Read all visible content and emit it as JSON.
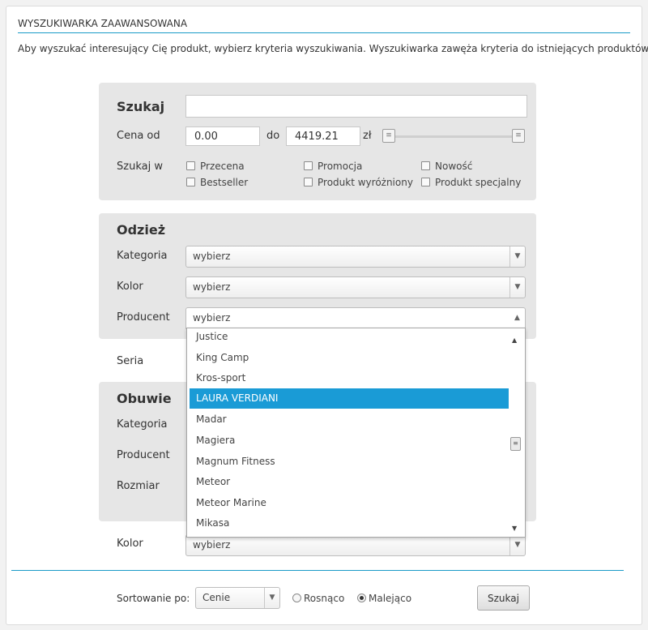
{
  "header": {
    "title": "WYSZUKIWARKA ZAAWANSOWANA",
    "intro": "Aby wyszukać interesujący Cię produkt, wybierz kryteria wyszukiwania. Wyszukiwarka zawęża kryteria do istniejących produktów."
  },
  "search": {
    "heading": "Szukaj",
    "query_value": "",
    "price_label": "Cena od",
    "price_from": "0.00",
    "price_to_label": "do",
    "price_to": "4419.21",
    "currency": "zł",
    "slider_range": [
      0.0,
      4419.21
    ],
    "search_in_label": "Szukaj w",
    "flags": [
      {
        "label": "Przecena",
        "checked": false
      },
      {
        "label": "Promocja",
        "checked": false
      },
      {
        "label": "Nowość",
        "checked": false
      },
      {
        "label": "Bestseller",
        "checked": false
      },
      {
        "label": "Produkt wyróżniony",
        "checked": false
      },
      {
        "label": "Produkt specjalny",
        "checked": false
      }
    ]
  },
  "odziez": {
    "heading": "Odzież",
    "kategoria_label": "Kategoria",
    "kategoria_value": "wybierz",
    "kolor_label": "Kolor",
    "kolor_value": "wybierz",
    "producent_label": "Producent",
    "producent_value": "wybierz"
  },
  "seria": {
    "label": "Seria"
  },
  "obuwie": {
    "heading": "Obuwie",
    "kategoria_label": "Kategoria",
    "producent_label": "Producent",
    "rozmiar_label": "Rozmiar",
    "kolor_label": "Kolor",
    "kolor_value": "wybierz"
  },
  "dropdown": {
    "items": [
      "Justice",
      "King Camp",
      "Kros-sport",
      "LAURA VERDIANI",
      "Madar",
      "Magiera",
      "Magnum Fitness",
      "Meteor",
      "Meteor Marine",
      "Mikasa"
    ],
    "selected": "LAURA VERDIANI"
  },
  "sort": {
    "label": "Sortowanie po:",
    "value": "Cenie",
    "asc_label": "Rosnąco",
    "desc_label": "Malejąco",
    "order": "desc",
    "button_label": "Szukaj"
  },
  "colors": {
    "accent": "#1a9bc8",
    "highlight": "#1a9bd6",
    "panel_bg": "#e6e6e6"
  },
  "icons": [
    "dropdown-arrow-icon",
    "slider-handle-grip-icon",
    "scroll-up-icon",
    "scroll-down-icon"
  ]
}
